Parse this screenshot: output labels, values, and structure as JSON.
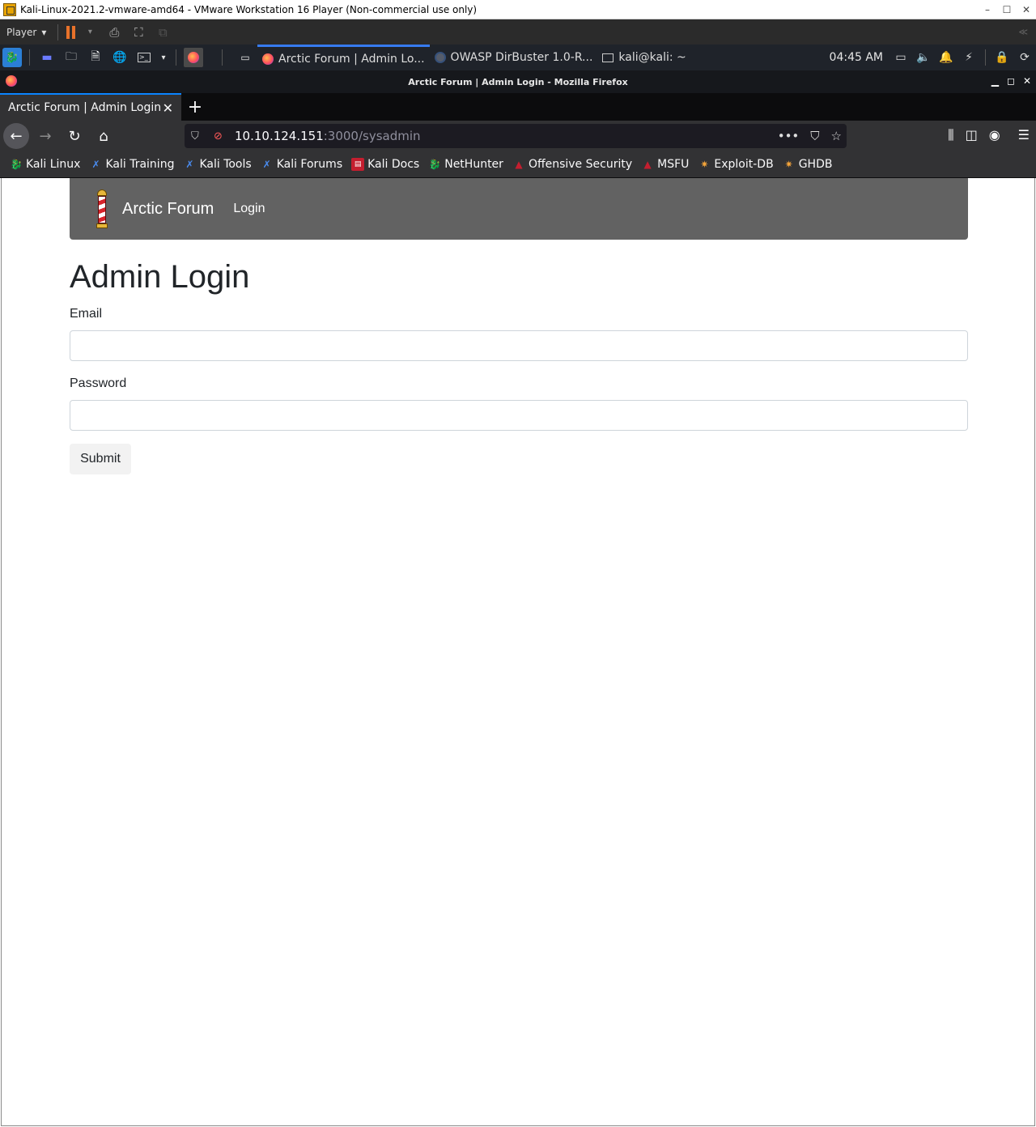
{
  "vmware": {
    "title": "Kali-Linux-2021.2-vmware-amd64 - VMware Workstation 16 Player (Non-commercial use only)",
    "player_menu": "Player",
    "window_controls": [
      "–",
      "☐",
      "✕"
    ]
  },
  "kali_panel": {
    "tasks": [
      {
        "label": "Arctic Forum | Admin Lo...",
        "icon": "firefox-icon",
        "active": true
      },
      {
        "label": "OWASP DirBuster 1.0-R...",
        "icon": "owasp-icon",
        "active": false
      },
      {
        "label": "kali@kali: ~",
        "icon": "terminal-icon",
        "active": false
      }
    ],
    "time": "04:45 AM"
  },
  "firefox": {
    "window_title": "Arctic Forum | Admin Login - Mozilla Firefox",
    "tab_title": "Arctic Forum | Admin Login",
    "url_host": "10.10.124.151",
    "url_path": ":3000/sysadmin",
    "bookmarks": [
      {
        "label": "Kali Linux",
        "icon": "kali-icon"
      },
      {
        "label": "Kali Training",
        "icon": "kali-training-icon"
      },
      {
        "label": "Kali Tools",
        "icon": "kali-tools-icon"
      },
      {
        "label": "Kali Forums",
        "icon": "kali-forums-icon"
      },
      {
        "label": "Kali Docs",
        "icon": "kali-docs-icon"
      },
      {
        "label": "NetHunter",
        "icon": "nethunter-icon"
      },
      {
        "label": "Offensive Security",
        "icon": "offsec-icon"
      },
      {
        "label": "MSFU",
        "icon": "msfu-icon"
      },
      {
        "label": "Exploit-DB",
        "icon": "exploitdb-icon"
      },
      {
        "label": "GHDB",
        "icon": "ghdb-icon"
      }
    ]
  },
  "site": {
    "brand": "Arctic Forum",
    "nav_login": "Login",
    "heading": "Admin Login",
    "email_label": "Email",
    "email_value": "",
    "password_label": "Password",
    "password_value": "",
    "submit_label": "Submit"
  },
  "colors": {
    "site_navbar": "#626262",
    "firefox_accent": "#0a84ff",
    "kali_panel": "#1f232a"
  }
}
